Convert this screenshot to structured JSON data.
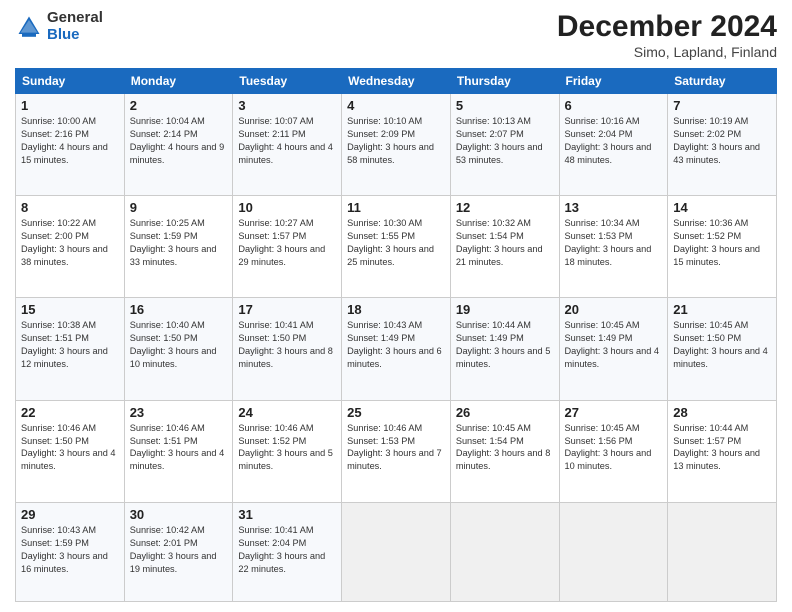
{
  "header": {
    "logo_general": "General",
    "logo_blue": "Blue",
    "month": "December 2024",
    "location": "Simo, Lapland, Finland"
  },
  "weekdays": [
    "Sunday",
    "Monday",
    "Tuesday",
    "Wednesday",
    "Thursday",
    "Friday",
    "Saturday"
  ],
  "weeks": [
    [
      {
        "day": "1",
        "sunrise": "Sunrise: 10:00 AM",
        "sunset": "Sunset: 2:16 PM",
        "daylight": "Daylight: 4 hours and 15 minutes."
      },
      {
        "day": "2",
        "sunrise": "Sunrise: 10:04 AM",
        "sunset": "Sunset: 2:14 PM",
        "daylight": "Daylight: 4 hours and 9 minutes."
      },
      {
        "day": "3",
        "sunrise": "Sunrise: 10:07 AM",
        "sunset": "Sunset: 2:11 PM",
        "daylight": "Daylight: 4 hours and 4 minutes."
      },
      {
        "day": "4",
        "sunrise": "Sunrise: 10:10 AM",
        "sunset": "Sunset: 2:09 PM",
        "daylight": "Daylight: 3 hours and 58 minutes."
      },
      {
        "day": "5",
        "sunrise": "Sunrise: 10:13 AM",
        "sunset": "Sunset: 2:07 PM",
        "daylight": "Daylight: 3 hours and 53 minutes."
      },
      {
        "day": "6",
        "sunrise": "Sunrise: 10:16 AM",
        "sunset": "Sunset: 2:04 PM",
        "daylight": "Daylight: 3 hours and 48 minutes."
      },
      {
        "day": "7",
        "sunrise": "Sunrise: 10:19 AM",
        "sunset": "Sunset: 2:02 PM",
        "daylight": "Daylight: 3 hours and 43 minutes."
      }
    ],
    [
      {
        "day": "8",
        "sunrise": "Sunrise: 10:22 AM",
        "sunset": "Sunset: 2:00 PM",
        "daylight": "Daylight: 3 hours and 38 minutes."
      },
      {
        "day": "9",
        "sunrise": "Sunrise: 10:25 AM",
        "sunset": "Sunset: 1:59 PM",
        "daylight": "Daylight: 3 hours and 33 minutes."
      },
      {
        "day": "10",
        "sunrise": "Sunrise: 10:27 AM",
        "sunset": "Sunset: 1:57 PM",
        "daylight": "Daylight: 3 hours and 29 minutes."
      },
      {
        "day": "11",
        "sunrise": "Sunrise: 10:30 AM",
        "sunset": "Sunset: 1:55 PM",
        "daylight": "Daylight: 3 hours and 25 minutes."
      },
      {
        "day": "12",
        "sunrise": "Sunrise: 10:32 AM",
        "sunset": "Sunset: 1:54 PM",
        "daylight": "Daylight: 3 hours and 21 minutes."
      },
      {
        "day": "13",
        "sunrise": "Sunrise: 10:34 AM",
        "sunset": "Sunset: 1:53 PM",
        "daylight": "Daylight: 3 hours and 18 minutes."
      },
      {
        "day": "14",
        "sunrise": "Sunrise: 10:36 AM",
        "sunset": "Sunset: 1:52 PM",
        "daylight": "Daylight: 3 hours and 15 minutes."
      }
    ],
    [
      {
        "day": "15",
        "sunrise": "Sunrise: 10:38 AM",
        "sunset": "Sunset: 1:51 PM",
        "daylight": "Daylight: 3 hours and 12 minutes."
      },
      {
        "day": "16",
        "sunrise": "Sunrise: 10:40 AM",
        "sunset": "Sunset: 1:50 PM",
        "daylight": "Daylight: 3 hours and 10 minutes."
      },
      {
        "day": "17",
        "sunrise": "Sunrise: 10:41 AM",
        "sunset": "Sunset: 1:50 PM",
        "daylight": "Daylight: 3 hours and 8 minutes."
      },
      {
        "day": "18",
        "sunrise": "Sunrise: 10:43 AM",
        "sunset": "Sunset: 1:49 PM",
        "daylight": "Daylight: 3 hours and 6 minutes."
      },
      {
        "day": "19",
        "sunrise": "Sunrise: 10:44 AM",
        "sunset": "Sunset: 1:49 PM",
        "daylight": "Daylight: 3 hours and 5 minutes."
      },
      {
        "day": "20",
        "sunrise": "Sunrise: 10:45 AM",
        "sunset": "Sunset: 1:49 PM",
        "daylight": "Daylight: 3 hours and 4 minutes."
      },
      {
        "day": "21",
        "sunrise": "Sunrise: 10:45 AM",
        "sunset": "Sunset: 1:50 PM",
        "daylight": "Daylight: 3 hours and 4 minutes."
      }
    ],
    [
      {
        "day": "22",
        "sunrise": "Sunrise: 10:46 AM",
        "sunset": "Sunset: 1:50 PM",
        "daylight": "Daylight: 3 hours and 4 minutes."
      },
      {
        "day": "23",
        "sunrise": "Sunrise: 10:46 AM",
        "sunset": "Sunset: 1:51 PM",
        "daylight": "Daylight: 3 hours and 4 minutes."
      },
      {
        "day": "24",
        "sunrise": "Sunrise: 10:46 AM",
        "sunset": "Sunset: 1:52 PM",
        "daylight": "Daylight: 3 hours and 5 minutes."
      },
      {
        "day": "25",
        "sunrise": "Sunrise: 10:46 AM",
        "sunset": "Sunset: 1:53 PM",
        "daylight": "Daylight: 3 hours and 7 minutes."
      },
      {
        "day": "26",
        "sunrise": "Sunrise: 10:45 AM",
        "sunset": "Sunset: 1:54 PM",
        "daylight": "Daylight: 3 hours and 8 minutes."
      },
      {
        "day": "27",
        "sunrise": "Sunrise: 10:45 AM",
        "sunset": "Sunset: 1:56 PM",
        "daylight": "Daylight: 3 hours and 10 minutes."
      },
      {
        "day": "28",
        "sunrise": "Sunrise: 10:44 AM",
        "sunset": "Sunset: 1:57 PM",
        "daylight": "Daylight: 3 hours and 13 minutes."
      }
    ],
    [
      {
        "day": "29",
        "sunrise": "Sunrise: 10:43 AM",
        "sunset": "Sunset: 1:59 PM",
        "daylight": "Daylight: 3 hours and 16 minutes."
      },
      {
        "day": "30",
        "sunrise": "Sunrise: 10:42 AM",
        "sunset": "Sunset: 2:01 PM",
        "daylight": "Daylight: 3 hours and 19 minutes."
      },
      {
        "day": "31",
        "sunrise": "Sunrise: 10:41 AM",
        "sunset": "Sunset: 2:04 PM",
        "daylight": "Daylight: 3 hours and 22 minutes."
      },
      null,
      null,
      null,
      null
    ]
  ]
}
